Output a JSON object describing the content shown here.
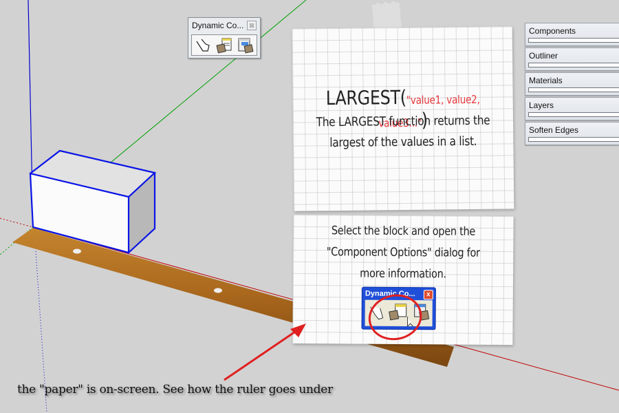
{
  "toolbar": {
    "title": "Dynamic Co...",
    "close_glyph": "⊠",
    "tools": [
      {
        "name": "interact-tool",
        "icon": "hand-pointer-icon"
      },
      {
        "name": "component-options-tool",
        "icon": "component-options-icon"
      },
      {
        "name": "component-attributes-tool",
        "icon": "component-attributes-icon"
      }
    ]
  },
  "tray": {
    "items": [
      {
        "label": "Components"
      },
      {
        "label": "Outliner"
      },
      {
        "label": "Materials"
      },
      {
        "label": "Layers"
      },
      {
        "label": "Soften Edges"
      }
    ]
  },
  "note1": {
    "function_name": "LARGEST(",
    "arguments": "\"value1, value2, value3...\"",
    "closing": ")",
    "line1": "The LARGEST function returns the",
    "line2": "largest of the values in a list."
  },
  "note2": {
    "line1": "Select the block and open the",
    "line2": "\"Component Options\" dialog for",
    "line3": "more information.",
    "mini_window_title": "Dynamic Co...",
    "mini_window_close": "x"
  },
  "caption": "the \"paper\" is on-screen. See how the ruler goes under",
  "colors": {
    "background": "#d2d2d2",
    "axis_red": "#c00000",
    "axis_green": "#00a000",
    "axis_blue": "#0000d0",
    "selection_blue": "#0a14e6",
    "annotation_red": "#e02020",
    "argument_red": "#e8383d"
  }
}
